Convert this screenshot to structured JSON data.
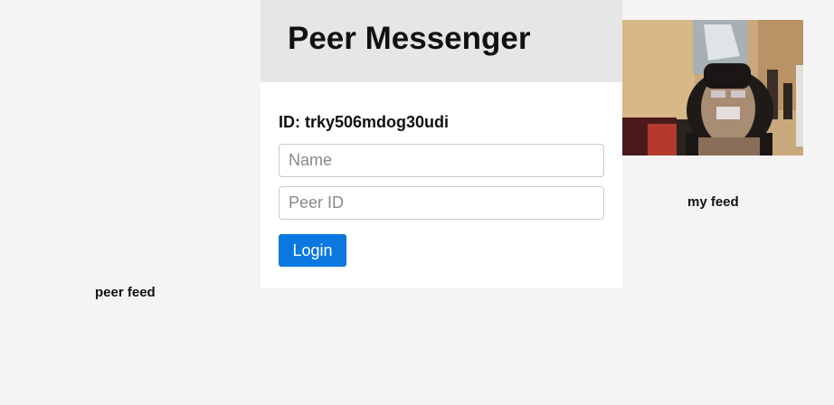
{
  "app": {
    "title": "Peer Messenger"
  },
  "login": {
    "id_text": "ID: trky506mdog30udi",
    "name_placeholder": "Name",
    "name_value": "",
    "peer_id_placeholder": "Peer ID",
    "peer_id_value": "",
    "login_label": "Login"
  },
  "feeds": {
    "my_feed_label": "my feed",
    "peer_feed_label": "peer feed"
  },
  "colors": {
    "header_bg": "#e6e6e6",
    "page_bg": "#f4f4f4",
    "button_bg": "#0a78df"
  }
}
